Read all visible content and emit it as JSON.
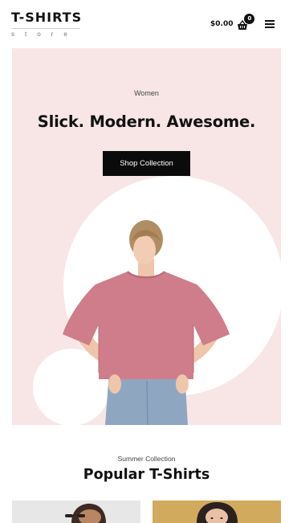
{
  "header": {
    "logo_main": "T-SHIRTS",
    "logo_sub": "store",
    "cart_total": "$0.00",
    "cart_count": "0",
    "cart_icon": "shopping-basket-icon",
    "menu_icon": "hamburger-menu-icon"
  },
  "hero": {
    "kicker": "Women",
    "title": "Slick. Modern. Awesome.",
    "button_label": "Shop Collection",
    "background_color": "#f8e6e7",
    "button_color": "#0b0b0b"
  },
  "collection": {
    "kicker": "Summer Collection",
    "title": "Popular T-Shirts"
  },
  "products": [
    {
      "name": "man-in-sunglasses-photo",
      "background_color": "#e7e7e7"
    },
    {
      "name": "woman-on-mustard-background-photo",
      "background_color": "#d1aa5d"
    }
  ]
}
